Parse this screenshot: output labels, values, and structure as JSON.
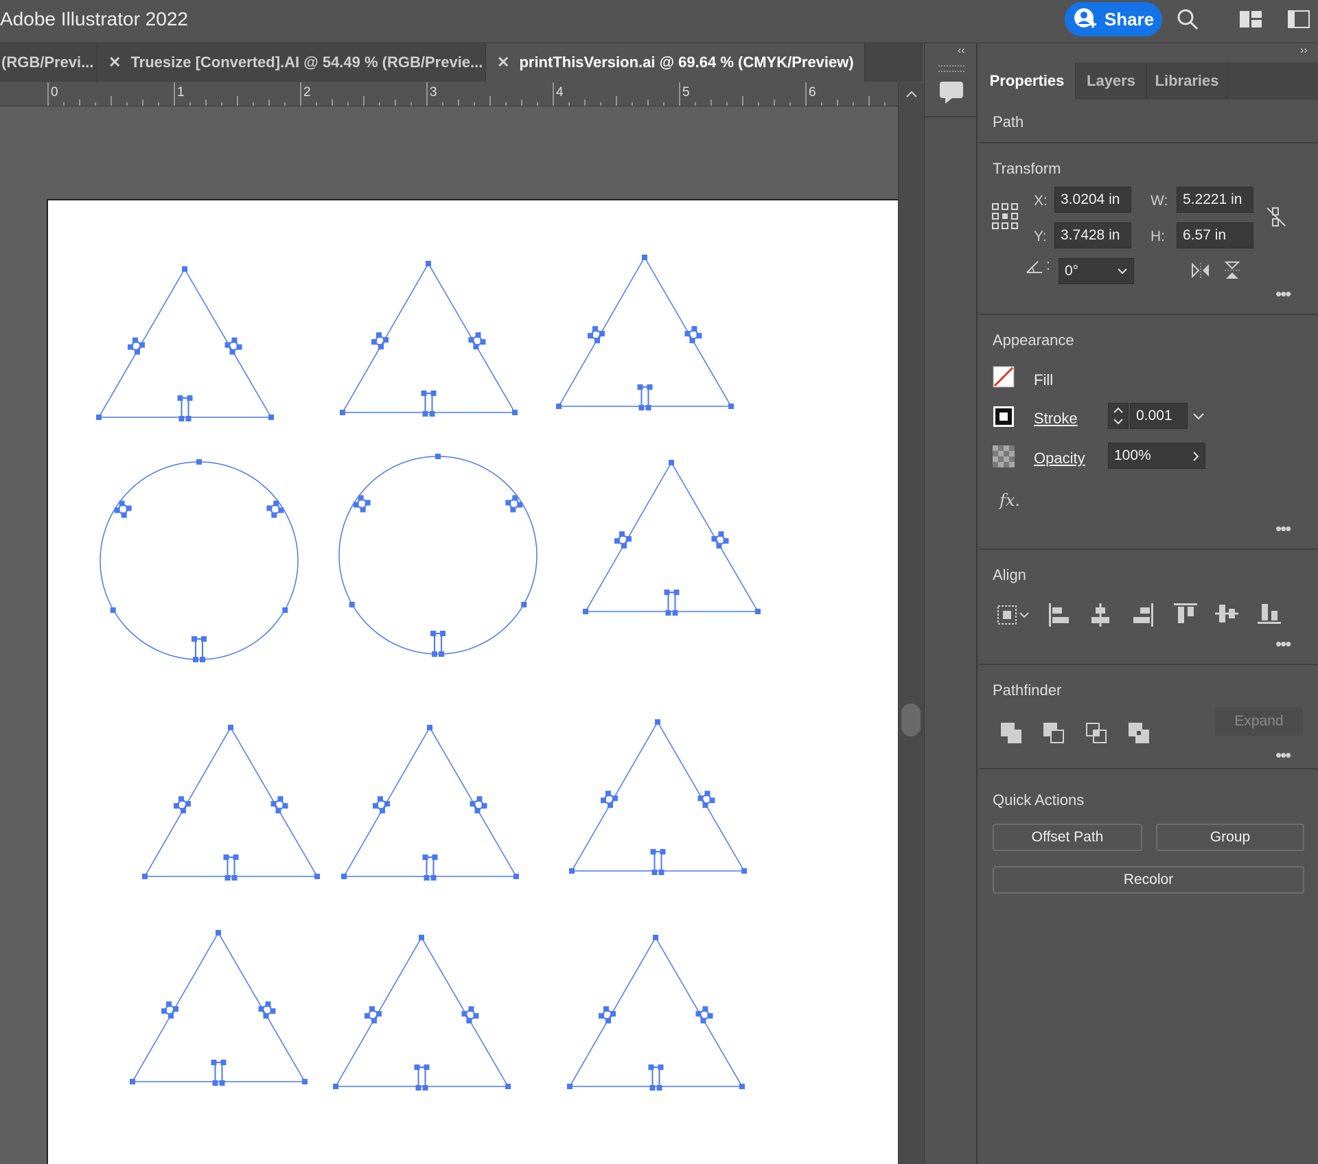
{
  "app": {
    "title": "Adobe Illustrator 2022"
  },
  "header": {
    "share_label": "Share"
  },
  "tabs": [
    {
      "label": "(RGB/Previ...",
      "closable": false,
      "active": false
    },
    {
      "label": "Truesize [Converted].AI @ 54.49 % (RGB/Previe...",
      "closable": true,
      "active": false
    },
    {
      "label": "printThisVersion.ai @ 69.64 % (CMYK/Preview)",
      "closable": true,
      "active": true
    }
  ],
  "ruler": {
    "ticks": [
      "0",
      "1",
      "2",
      "3",
      "4",
      "5",
      "6"
    ]
  },
  "panel": {
    "tabs": [
      "Properties",
      "Layers",
      "Libraries"
    ],
    "object_type": "Path",
    "transform": {
      "title": "Transform",
      "x_label": "X:",
      "x_value": "3.0204 in",
      "y_label": "Y:",
      "y_value": "3.7428 in",
      "w_label": "W:",
      "w_value": "5.2221 in",
      "h_label": "H:",
      "h_value": "6.57 in",
      "angle_value": "0°"
    },
    "appearance": {
      "title": "Appearance",
      "fill_label": "Fill",
      "stroke_label": "Stroke",
      "stroke_value": "0.001",
      "opacity_label": "Opacity",
      "opacity_value": "100%",
      "fx_label": "fx."
    },
    "align": {
      "title": "Align"
    },
    "pathfinder": {
      "title": "Pathfinder",
      "expand_label": "Expand"
    },
    "quick_actions": {
      "title": "Quick Actions",
      "offset_path_label": "Offset Path",
      "group_label": "Group",
      "recolor_label": "Recolor"
    }
  },
  "colors": {
    "selection": "#4a78f0",
    "accent": "#1473e6",
    "fill_none": "#e0352b"
  }
}
